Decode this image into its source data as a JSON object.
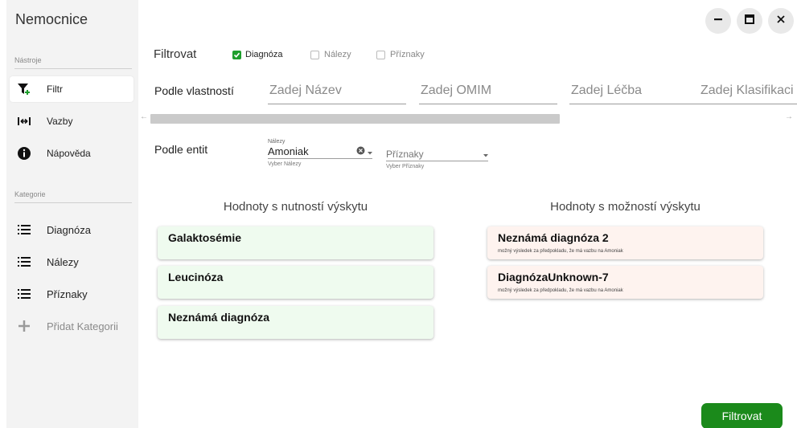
{
  "app": {
    "title": "Nemocnice"
  },
  "window_controls": {
    "minimize_icon": "minimize-icon",
    "maximize_icon": "maximize-icon",
    "close_icon": "close-icon"
  },
  "sidebar": {
    "tools_label": "Nástroje",
    "tools": [
      {
        "label": "Filtr",
        "icon": "filter-add-icon",
        "active": true
      },
      {
        "label": "Vazby",
        "icon": "link-arrows-icon",
        "active": false
      },
      {
        "label": "Nápověda",
        "icon": "info-icon",
        "active": false
      }
    ],
    "categories_label": "Kategorie",
    "categories": [
      {
        "label": "Diagnóza",
        "icon": "list-icon"
      },
      {
        "label": "Nálezy",
        "icon": "list-icon"
      },
      {
        "label": "Příznaky",
        "icon": "list-icon"
      }
    ],
    "add_category": {
      "label": "Přidat Kategorii",
      "icon": "plus-icon",
      "disabled": true
    }
  },
  "filter": {
    "title": "Filtrovat",
    "checkboxes": [
      {
        "label": "Diagnóza",
        "checked": true
      },
      {
        "label": "Nálezy",
        "checked": false
      },
      {
        "label": "Příznaky",
        "checked": false
      }
    ]
  },
  "properties": {
    "label": "Podle vlastností",
    "inputs": [
      {
        "placeholder": "Zadej Název",
        "value": ""
      },
      {
        "placeholder": "Zadej OMIM",
        "value": ""
      },
      {
        "placeholder": "Zadej Léčba",
        "value": ""
      },
      {
        "placeholder": "Zadej Klasifikaci",
        "value": ""
      }
    ]
  },
  "entities": {
    "label": "Podle entit",
    "findings": {
      "floating_label": "Nálezy",
      "value": "Amoniak",
      "helper": "Vyber Nálezy"
    },
    "symptoms": {
      "placeholder": "Příznaky",
      "helper": "Vyber Příznaky"
    }
  },
  "results": {
    "required_heading": "Hodnoty s nutností výskytu",
    "required": [
      {
        "title": "Galaktosémie"
      },
      {
        "title": "Leucinóza"
      },
      {
        "title": "Neznámá diagnóza"
      }
    ],
    "possible_heading": "Hodnoty s možností výskytu",
    "possible": [
      {
        "title": "Neznámá diagnóza 2",
        "subtitle": "možný výsledek za předpokladu, že má vazbu na Amoniak"
      },
      {
        "title": "DiagnózaUnknown-7",
        "subtitle": "možný výsledek za předpokladu, že má vazbu na Amoniak"
      }
    ]
  },
  "actions": {
    "filter_button": "Filtrovat"
  },
  "colors": {
    "accent": "#1e9e2c",
    "button": "#1b8a1b",
    "required_card": "#effbef",
    "possible_card": "#fef3ef",
    "sidebar": "#f3f3f3"
  }
}
